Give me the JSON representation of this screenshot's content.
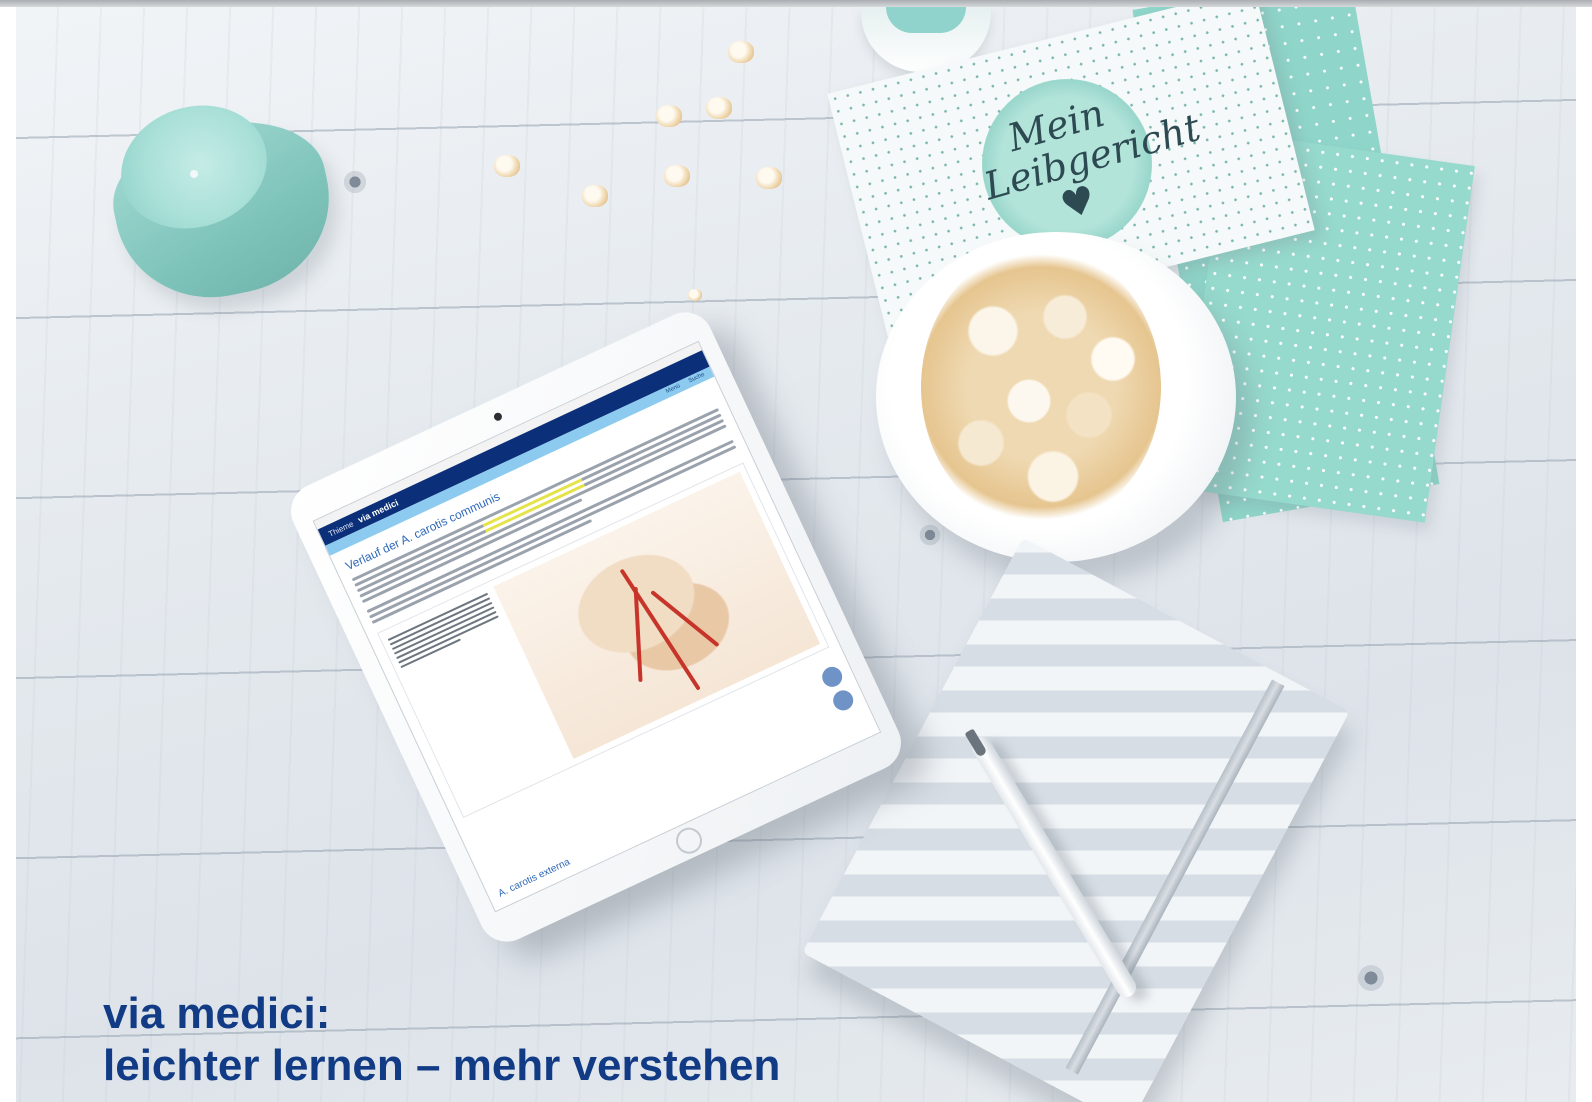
{
  "tablet_screen": {
    "brand": "via medici",
    "publisher": "Thieme",
    "nav_items": [
      "Menü",
      "Suche"
    ],
    "section_title": "Verlauf der A. carotis communis",
    "next_section": "A. carotis externa"
  },
  "napkin_text": "Mein Leibgericht ♥",
  "headline": {
    "line1": "via medici:",
    "line2": "leichter lernen – mehr verstehen"
  },
  "colors": {
    "headline": "#123b86",
    "mint": "#8fd5c9",
    "appbar": "#0b2f78"
  }
}
